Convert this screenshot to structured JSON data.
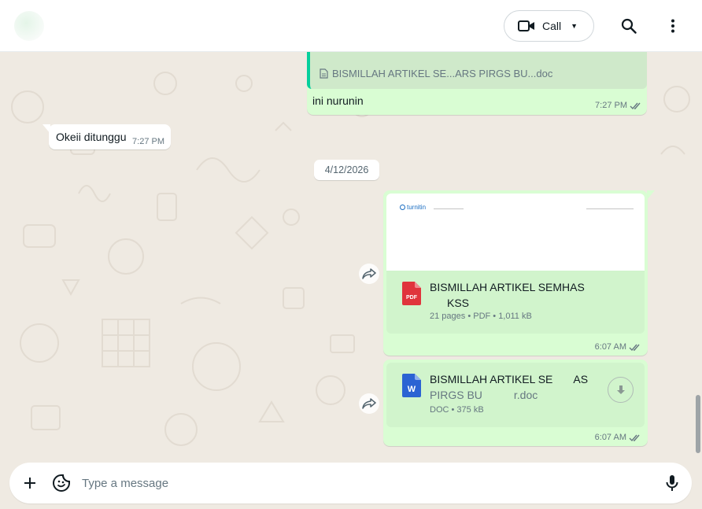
{
  "header": {
    "contact_name": "",
    "call_label": "Call"
  },
  "messages": {
    "quoted": {
      "file_name": "BISMILLAH ARTIKEL SE...ARS PIRGS BU...doc",
      "text": "ini nurunin",
      "time": "7:27 PM"
    },
    "incoming": {
      "text": "Okeii ditunggu",
      "time": "7:27 PM"
    },
    "date_divider": "4/12/2026",
    "pdf": {
      "preview_logo": "turnitin",
      "file_name": "BISMILLAH ARTIKEL SEMHAS",
      "file_name_suffix": "KSS",
      "meta": "21 pages • PDF • 1,011 kB",
      "time": "6:07 AM"
    },
    "doc": {
      "file_name": "BISMILLAH ARTIKEL SE",
      "file_name_suffix": "AS",
      "file_name_line2": "PIRGS BU",
      "file_name_line2_suffix": "r.doc",
      "meta": "DOC • 375 kB",
      "time": "6:07 AM"
    }
  },
  "composer": {
    "placeholder": "Type a message"
  },
  "icons": {
    "video": "video-camera-icon",
    "search": "search-icon",
    "menu": "kebab-menu-icon",
    "plus": "plus-icon",
    "sticker": "sticker-icon",
    "mic": "microphone-icon",
    "forward": "forward-icon",
    "download": "download-icon"
  },
  "colors": {
    "outgoing_bubble": "#d9fdd3",
    "file_card": "#d1f4cc",
    "quote_bar": "#06cf9c",
    "read_ticks": "#667781",
    "pdf_icon": "#e0343c",
    "doc_icon": "#2b63d3"
  }
}
